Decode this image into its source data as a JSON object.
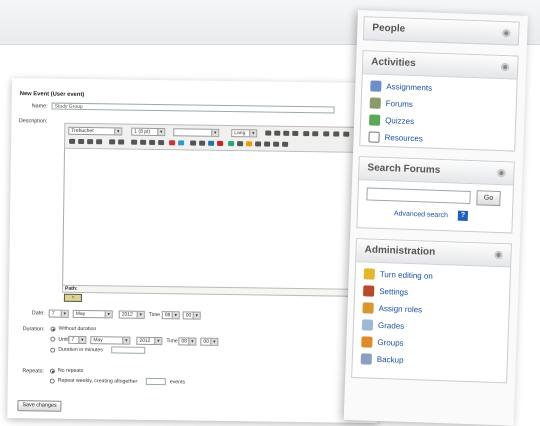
{
  "event_form": {
    "title": "New Event (User event)",
    "name_label": "Name:",
    "name_value": "Study Group",
    "description_label": "Description:",
    "font_family": "Trebuchet",
    "font_size": "1 (8 pt)",
    "lang": "Lang",
    "path_label": "Path:",
    "date_label": "Date:",
    "date_day": "7",
    "date_month": "May",
    "date_year": "2012",
    "time_label": "Time",
    "time_hour": "08",
    "time_min": "00",
    "duration_label": "Duration:",
    "without_duration": "Without duration",
    "until_label": "Until",
    "until_day": "7",
    "until_month": "May",
    "until_year": "2012",
    "until_hour": "08",
    "until_min": "00",
    "duration_minutes": "Duration in minutes",
    "repeats_label": "Repeats:",
    "no_repeats": "No repeats",
    "repeat_weekly": "Repeat weekly, creating altogether",
    "events_label": "events",
    "save_label": "Save changes"
  },
  "sidebar": {
    "people": {
      "title": "People"
    },
    "activities": {
      "title": "Activities",
      "items": [
        {
          "label": "Assignments",
          "icon": "assignment-icon"
        },
        {
          "label": "Forums",
          "icon": "forum-icon"
        },
        {
          "label": "Quizzes",
          "icon": "quiz-icon"
        },
        {
          "label": "Resources",
          "icon": "resource-icon"
        }
      ]
    },
    "search_forums": {
      "title": "Search Forums",
      "go_label": "Go",
      "advanced_label": "Advanced search",
      "help_label": "?"
    },
    "administration": {
      "title": "Administration",
      "items": [
        {
          "label": "Turn editing on",
          "icon": "pencil-icon"
        },
        {
          "label": "Settings",
          "icon": "settings-icon"
        },
        {
          "label": "Assign roles",
          "icon": "roles-icon"
        },
        {
          "label": "Grades",
          "icon": "grades-icon"
        },
        {
          "label": "Groups",
          "icon": "groups-icon"
        },
        {
          "label": "Backup",
          "icon": "backup-icon"
        }
      ]
    }
  }
}
